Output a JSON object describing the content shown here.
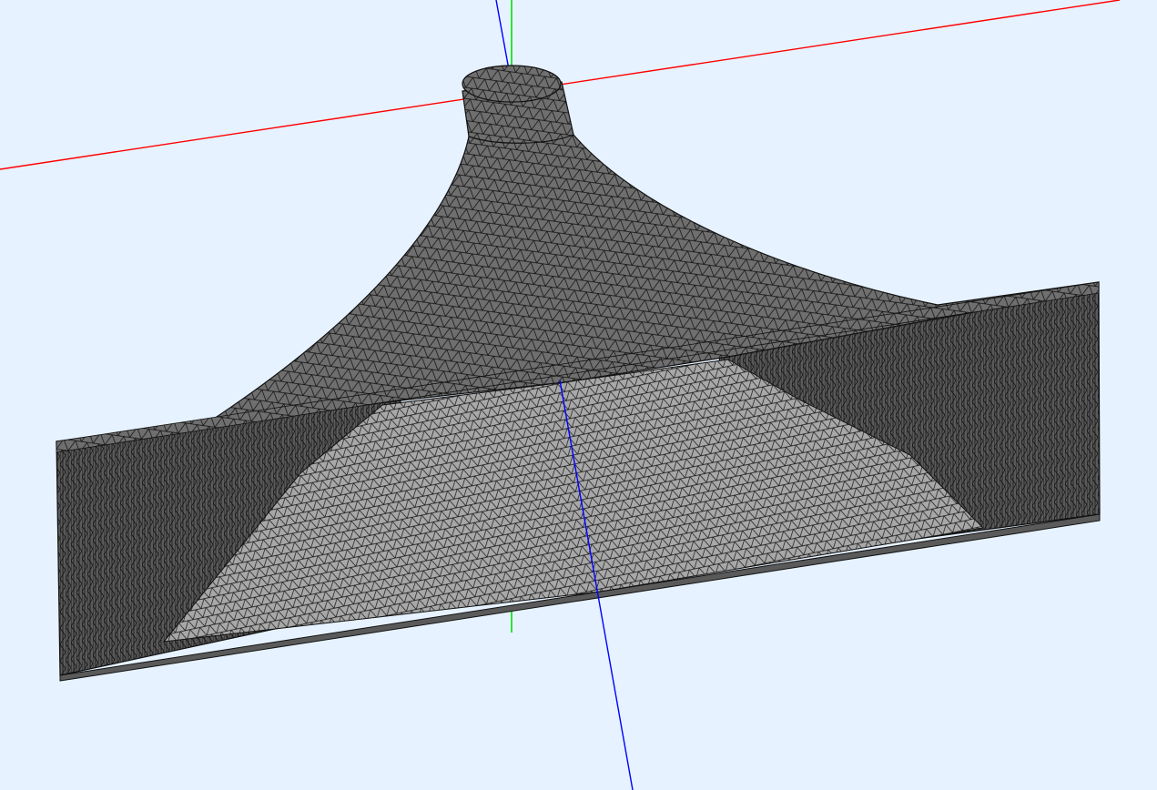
{
  "viewport": {
    "background": "#e6f2ff",
    "axes": {
      "x_axis_color": "#ff0000",
      "y_axis_color": "#00dd00",
      "z_axis_color": "#0000ff"
    },
    "mesh": {
      "element_type": "triangle",
      "face_fill": "#9a9a9a",
      "face_fill_light": "#b0b0b0",
      "face_fill_dark": "#6e6e6e",
      "edge_color": "#111111"
    }
  }
}
